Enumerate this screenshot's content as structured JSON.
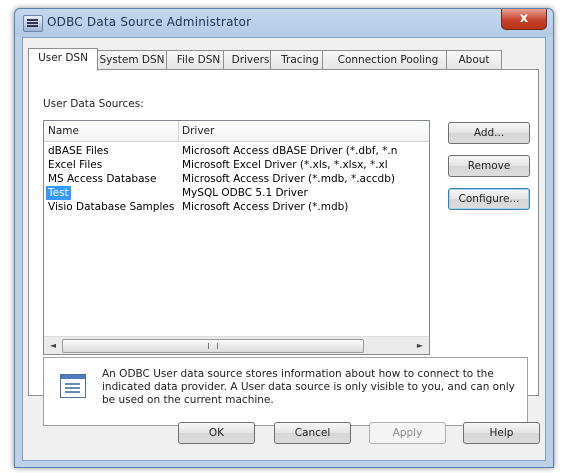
{
  "window": {
    "title": "ODBC Data Source Administrator",
    "close_label": "x"
  },
  "tabs": [
    {
      "label": "User DSN",
      "active": true
    },
    {
      "label": "System DSN"
    },
    {
      "label": "File DSN"
    },
    {
      "label": "Drivers"
    },
    {
      "label": "Tracing"
    },
    {
      "label": "Connection Pooling"
    },
    {
      "label": "About"
    }
  ],
  "user_dsn": {
    "section_label": "User Data Sources:",
    "columns": {
      "name": "Name",
      "driver": "Driver"
    },
    "rows": [
      {
        "name": "dBASE Files",
        "driver": "Microsoft Access dBASE Driver (*.dbf, *.n"
      },
      {
        "name": "Excel Files",
        "driver": "Microsoft Excel Driver (*.xls, *.xlsx, *.xl"
      },
      {
        "name": "MS Access Database",
        "driver": "Microsoft Access Driver (*.mdb, *.accdb)"
      },
      {
        "name": "Test",
        "driver": "MySQL ODBC 5.1 Driver",
        "selected": true
      },
      {
        "name": "Visio Database Samples",
        "driver": "Microsoft Access Driver (*.mdb)"
      }
    ],
    "side_buttons": {
      "add": "Add...",
      "remove": "Remove",
      "configure": "Configure..."
    },
    "scroll": {
      "left": "◄",
      "grip": "III",
      "right": "►"
    },
    "info_text": "An ODBC User data source stores information about how to connect to the indicated data provider.   A User data source is only visible to you, and can only be used on the current machine."
  },
  "footer_buttons": {
    "ok": "OK",
    "cancel": "Cancel",
    "apply": "Apply",
    "help": "Help"
  }
}
